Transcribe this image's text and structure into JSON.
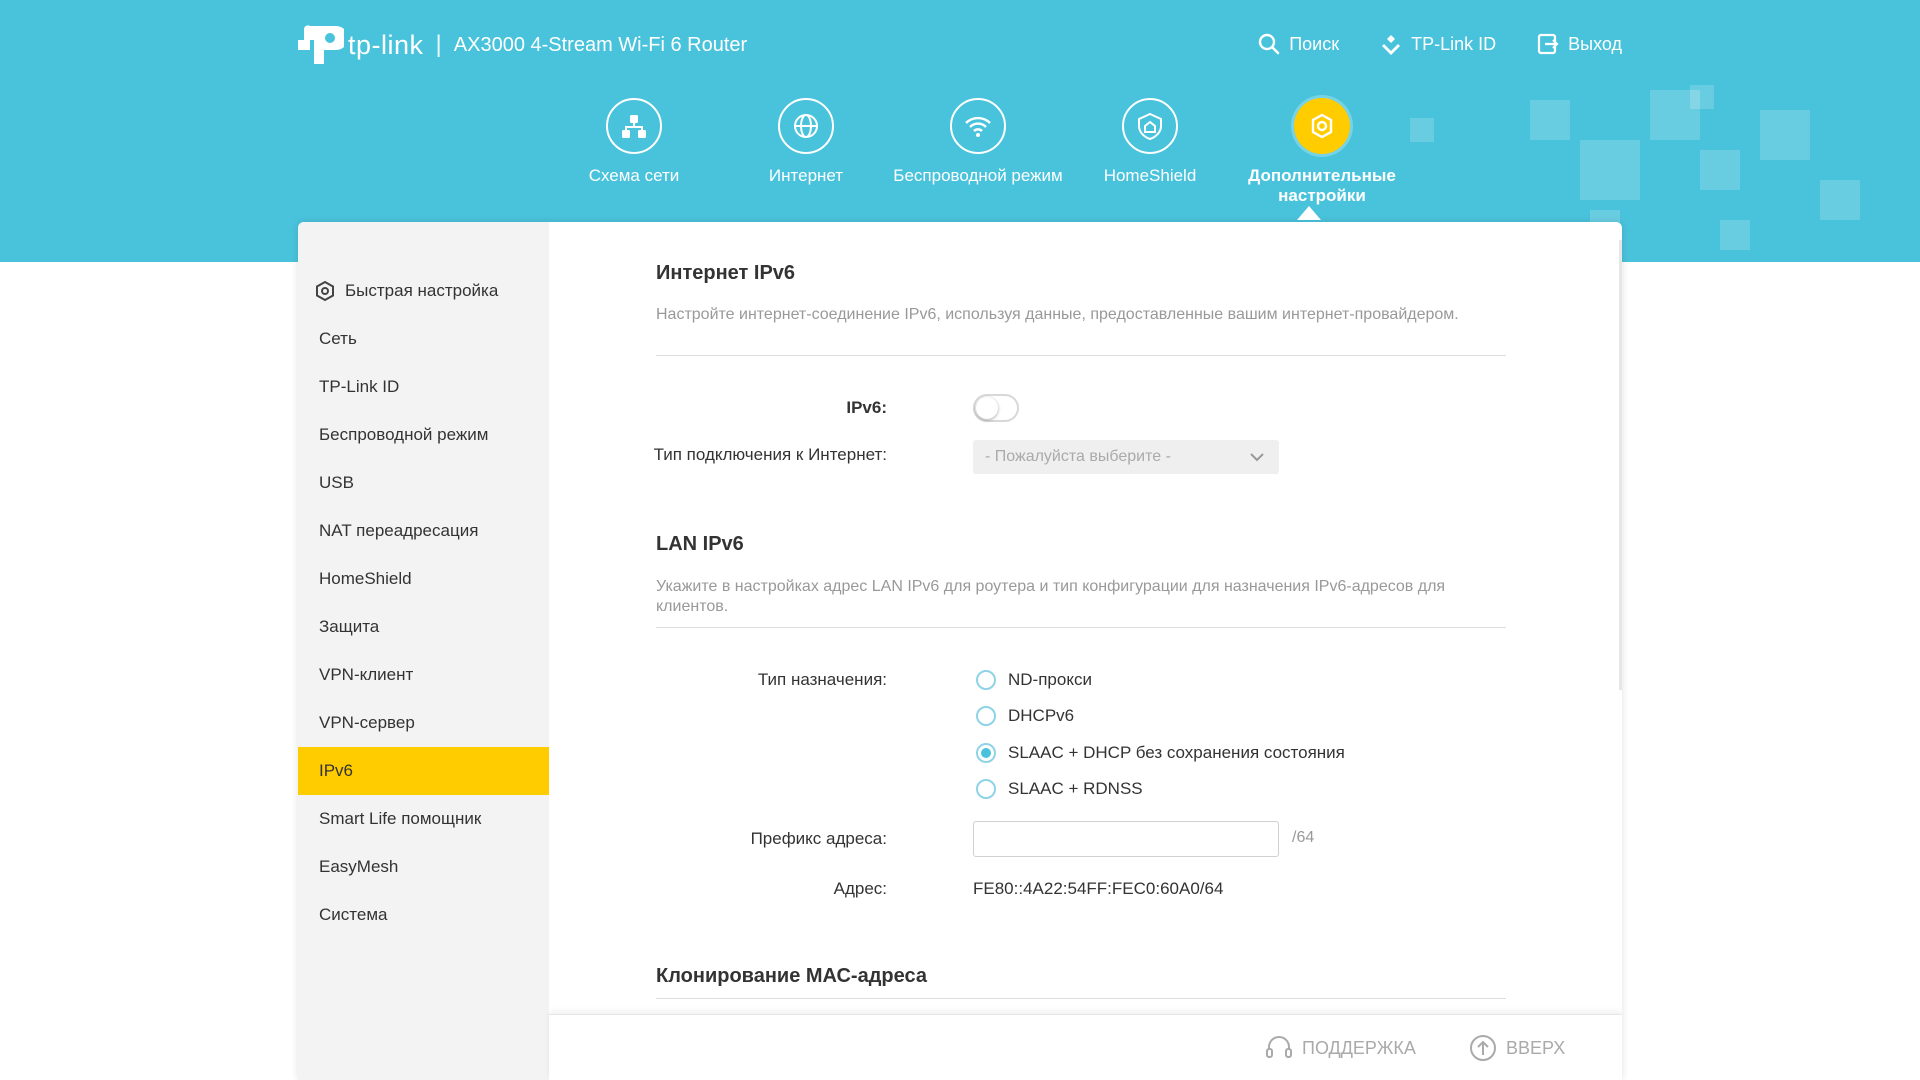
{
  "header": {
    "brand": "tp-link",
    "separator": "|",
    "product": "AX3000 4-Stream Wi-Fi 6 Router",
    "actions": [
      {
        "label": "Поиск",
        "icon": "search-icon"
      },
      {
        "label": "TP-Link ID",
        "icon": "tplink-id-icon"
      },
      {
        "label": "Выход",
        "icon": "logout-icon"
      }
    ]
  },
  "nav": {
    "items": [
      {
        "label": "Схема сети",
        "icon": "network-map-icon",
        "active": false
      },
      {
        "label": "Интернет",
        "icon": "globe-icon",
        "active": false
      },
      {
        "label": "Беспроводной режим",
        "icon": "wifi-icon",
        "active": false
      },
      {
        "label": "HomeShield",
        "icon": "homeshield-icon",
        "active": false
      },
      {
        "label": "Дополнительные настройки",
        "icon": "advanced-gear-icon",
        "active": true
      }
    ]
  },
  "sidebar": {
    "items": [
      {
        "label": "Быстрая настройка",
        "icon": "quick-setup-gear-icon"
      },
      {
        "label": "Сеть"
      },
      {
        "label": "TP-Link ID"
      },
      {
        "label": "Беспроводной режим"
      },
      {
        "label": "USB"
      },
      {
        "label": "NAT переадресация"
      },
      {
        "label": "HomeShield"
      },
      {
        "label": "Защита"
      },
      {
        "label": "VPN-клиент"
      },
      {
        "label": "VPN-сервер"
      },
      {
        "label": "IPv6",
        "active": true
      },
      {
        "label": "Smart Life помощник"
      },
      {
        "label": "EasyMesh"
      },
      {
        "label": "Система"
      }
    ]
  },
  "internet_ipv6": {
    "title": "Интернет IPv6",
    "description": "Настройте интернет-соединение IPv6, используя данные, предоставленные вашим интернет-провайдером.",
    "ipv6_label": "IPv6:",
    "ipv6_enabled": false,
    "connection_type_label": "Тип подключения к Интернет:",
    "connection_type_placeholder": "- Пожалуйста выберите -"
  },
  "lan_ipv6": {
    "title": "LAN IPv6",
    "description": "Укажите в настройках адрес LAN IPv6 для роутера и тип конфигурации для назначения IPv6-адресов для клиентов.",
    "assign_type_label": "Тип назначения:",
    "options": [
      {
        "label": "ND-прокси",
        "checked": false
      },
      {
        "label": "DHCPv6",
        "checked": false
      },
      {
        "label": "SLAAC + DHCP без сохранения состояния",
        "checked": true
      },
      {
        "label": "SLAAC + RDNSS",
        "checked": false
      }
    ],
    "prefix_label": "Префикс адреса:",
    "prefix_value": "",
    "prefix_suffix": "/64",
    "address_label": "Адрес:",
    "address_value": "FE80::4A22:54FF:FEC0:60A0/64"
  },
  "mac_clone": {
    "title": "Клонирование МАС-адреса"
  },
  "footer": {
    "support": "ПОДДЕРЖКА",
    "top": "ВВЕРХ"
  },
  "colors": {
    "header": "#49c3dc",
    "accent": "#ffcc00",
    "sidebar_bg": "#f3f3f3"
  }
}
